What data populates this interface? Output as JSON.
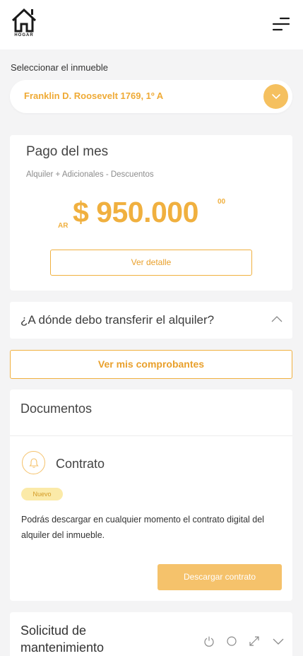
{
  "header": {
    "logo_text": "HOGAR",
    "logo_icon": "house-icon",
    "menu_icon": "hamburger-menu-icon"
  },
  "property": {
    "label": "Seleccionar el inmueble",
    "selected": "Franklin D. Roosevelt 1769, 1º A",
    "arrow_icon": "chevron-down-icon"
  },
  "pago": {
    "title": "Pago del mes",
    "subtitle": "Alquiler + Adicionales - Descuentos",
    "currency_prefix": "AR",
    "amount": "$ 950.000",
    "cents": "00",
    "detail_button": "Ver detalle"
  },
  "transfer": {
    "question": "¿A dónde debo transferir el alquiler?",
    "icon": "chevron-up-icon"
  },
  "comprobantes_button": "Ver mis comprobantes",
  "documentos": {
    "title": "Documentos",
    "item_title": "Contrato",
    "item_icon": "bell-icon",
    "badge": "Nuevo",
    "description": "Podrás descargar en cualquier momento el contrato digital del alquiler del inmueble.",
    "download_button": "Descargar contrato"
  },
  "mantenimiento": {
    "title": "Solicitud de mantenimiento",
    "icons": [
      "power-icon",
      "circle-icon",
      "expand-icon",
      "chevron-down-icon"
    ]
  },
  "colors": {
    "accent": "#f0b03f",
    "accent_light": "#f5c26b",
    "badge_bg": "#fbeaa8",
    "background": "#f4f4f5"
  }
}
